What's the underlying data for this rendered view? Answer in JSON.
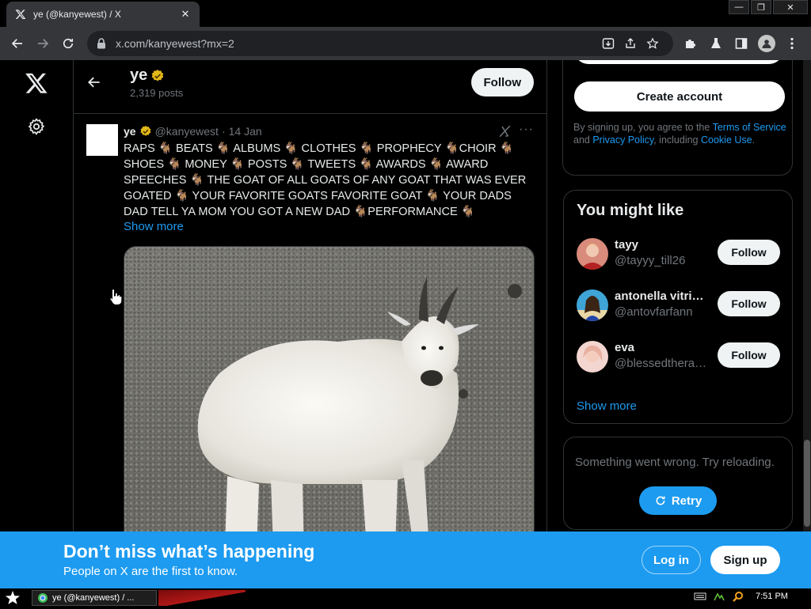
{
  "browser": {
    "tab_title": "ye (@kanyewest) / X",
    "tab_close": "✕",
    "url": "x.com/kanyewest?mx=2",
    "window_min": "—",
    "window_restore": "❐",
    "window_close": "✕"
  },
  "profile_header": {
    "name": "ye",
    "posts_count": "2,319 posts",
    "follow_label": "Follow"
  },
  "tweet": {
    "author_name": "ye",
    "handle": "@kanyewest",
    "separator": "·",
    "date": "14 Jan",
    "more": "···",
    "text": "RAPS 🐐 BEATS 🐐 ALBUMS 🐐 CLOTHES 🐐 PROPHECY 🐐CHOIR 🐐 SHOES 🐐 MONEY 🐐 POSTS 🐐 TWEETS 🐐 AWARDS 🐐 AWARD SPEECHES 🐐 THE GOAT OF ALL GOATS OF ANY GOAT THAT WAS EVER GOATED 🐐 YOUR FAVORITE GOATS FAVORITE GOAT 🐐 YOUR DADS DAD  TELL YA MOM YOU GOT A NEW DAD 🐐PERFORMANCE 🐐",
    "show_more": "Show more"
  },
  "signup_card": {
    "create_account": "Create account",
    "terms_prefix": "By signing up, you agree to the ",
    "terms_link": "Terms of Service",
    "terms_and": " and ",
    "privacy_link": "Privacy Policy",
    "terms_including": ", including ",
    "cookie_link": "Cookie Use",
    "terms_end": "."
  },
  "you_might_like": {
    "title": "You might like",
    "users": [
      {
        "name": "tayy",
        "handle": "@tayyy_till26",
        "follow_label": "Follow",
        "avatar_color": "#c0392b"
      },
      {
        "name": "antonella vitri…",
        "handle": "@antovfarfann",
        "follow_label": "Follow",
        "avatar_color": "#2e86c1"
      },
      {
        "name": "eva",
        "handle": "@blessedthera…",
        "follow_label": "Follow",
        "avatar_color": "#f5b7b1"
      }
    ],
    "show_more": "Show more"
  },
  "error_card": {
    "message": "Something went wrong. Try reloading.",
    "retry_label": "Retry"
  },
  "banner": {
    "title": "Don’t miss what’s happening",
    "subtitle": "People on X are the first to know.",
    "login_label": "Log in",
    "signup_label": "Sign up"
  },
  "taskbar": {
    "task_title": "ye (@kanyewest) / ...",
    "clock": "7:51 PM"
  },
  "colors": {
    "accent": "#1d9bf0",
    "verified": "#e2b719",
    "background": "#000000"
  }
}
